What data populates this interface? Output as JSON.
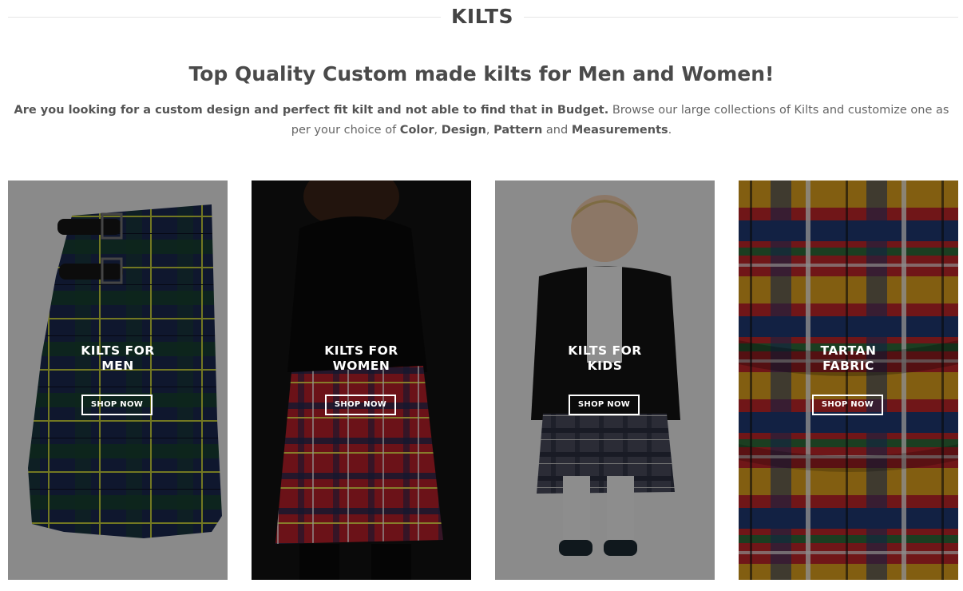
{
  "section": {
    "title": "KILTS"
  },
  "headline": "Top Quality Custom made kilts for Men and Women!",
  "intro": {
    "bold_lead": "Are you looking for a custom design and perfect fit kilt and not able to find that in Budget.",
    "text_1": " Browse our large collections of Kilts and customize one as per your choice of ",
    "color": "Color",
    "sep_1": ", ",
    "design": "Design",
    "sep_2": ", ",
    "pattern": "Pattern",
    "and": " and ",
    "measurements": "Measurements",
    "end": "."
  },
  "cards": [
    {
      "line1": "KILTS FOR",
      "line2": "MEN",
      "button": "SHOP NOW"
    },
    {
      "line1": "KILTS FOR",
      "line2": "WOMEN",
      "button": "SHOP NOW"
    },
    {
      "line1": "KILTS FOR",
      "line2": "KIDS",
      "button": "SHOP NOW"
    },
    {
      "line1": "TARTAN",
      "line2": "FABRIC",
      "button": "SHOP NOW"
    }
  ],
  "colors": {
    "overlay": "rgba(0,0,0,0.42)",
    "men_tartan_base": "#1c2a52",
    "men_tartan_stripe": "#b9c23a",
    "women_tartan_base": "#b8222a",
    "fabric_base": "#b8312a"
  }
}
